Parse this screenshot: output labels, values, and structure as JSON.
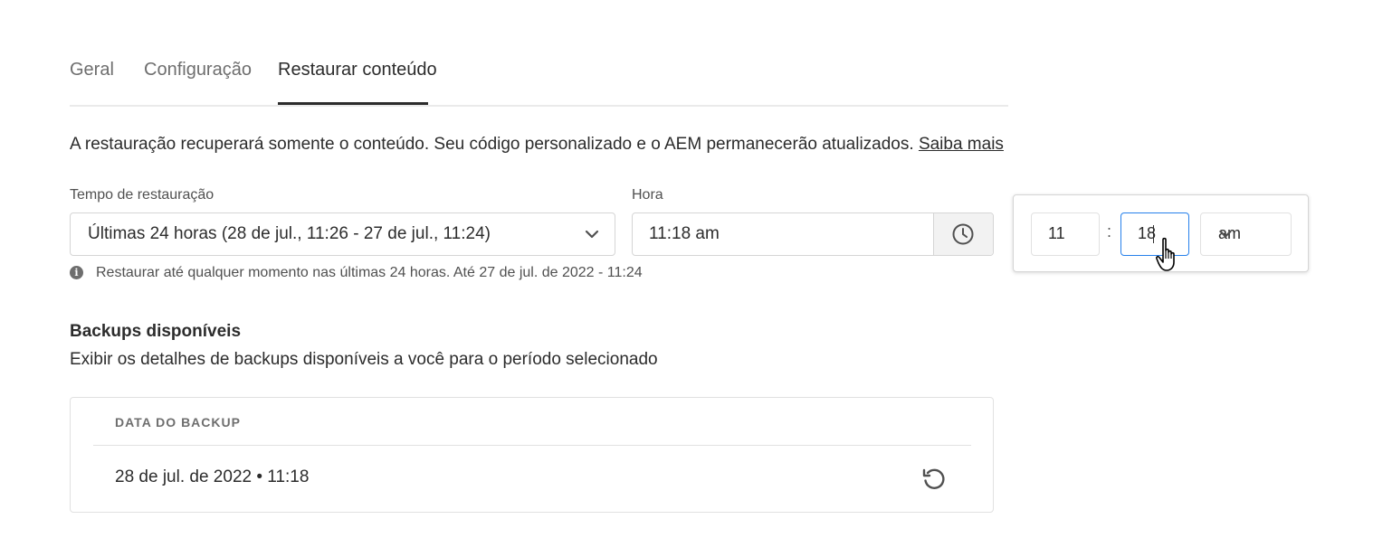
{
  "tabs": [
    {
      "label": "Geral",
      "selected": false
    },
    {
      "label": "Configuração",
      "selected": false
    },
    {
      "label": "Restaurar conteúdo",
      "selected": true
    }
  ],
  "description": {
    "text": "A restauração recuperará somente o conteúdo. Seu código personalizado e o AEM permanecerão atualizados.",
    "link": "Saiba mais"
  },
  "restore_time": {
    "label": "Tempo de restauração",
    "value": "Últimas 24 horas (28 de jul., 11:26 - 27 de jul., 11:24)"
  },
  "time": {
    "label": "Hora",
    "value": "11:18 am"
  },
  "help_text": "Restaurar até qualquer momento nas últimas 24 horas. Até 27 de jul. de 2022 - 11:24",
  "backups": {
    "title": "Backups disponíveis",
    "subtitle": "Exibir os detalhes de backups disponíveis a você para o período selecionado",
    "column_header": "DATA DO BACKUP",
    "rows": [
      {
        "date": "28 de jul. de 2022 • 11:18"
      }
    ]
  },
  "time_picker": {
    "hour": "11",
    "separator": ":",
    "minute": "18",
    "period": "am"
  },
  "icons": {
    "clock": "clock-icon",
    "restore": "restore-icon",
    "info": "info-icon",
    "chevron": "chevron-down-icon",
    "cursor": "hand-pointer-icon"
  },
  "colors": {
    "focus_border": "#2680eb",
    "text": "#2c2c2c"
  }
}
